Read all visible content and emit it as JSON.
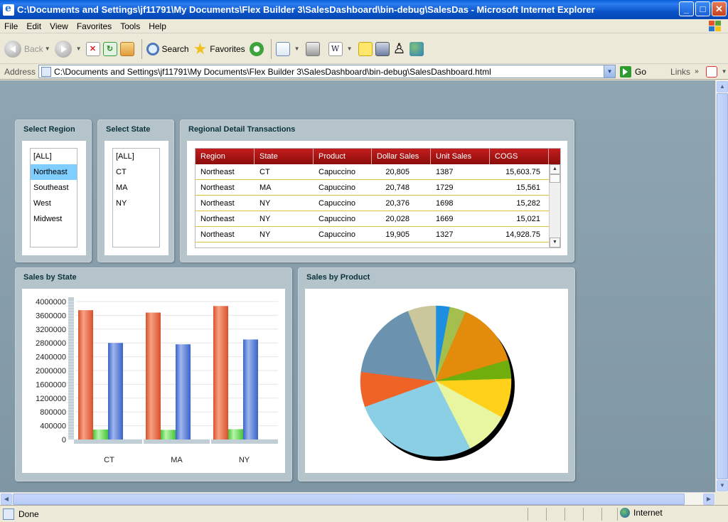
{
  "window": {
    "title": "C:\\Documents and Settings\\jf11791\\My Documents\\Flex Builder 3\\SalesDashboard\\bin-debug\\SalesDas - Microsoft Internet Explorer",
    "minimize": "_",
    "maximize": "□",
    "close": "✕"
  },
  "menu": [
    "File",
    "Edit",
    "View",
    "Favorites",
    "Tools",
    "Help"
  ],
  "toolbar": {
    "back": "Back",
    "search": "Search",
    "favorites": "Favorites"
  },
  "address": {
    "label": "Address",
    "url": "C:\\Documents and Settings\\jf11791\\My Documents\\Flex Builder 3\\SalesDashboard\\bin-debug\\SalesDashboard.html",
    "go": "Go",
    "links": "Links"
  },
  "status": {
    "text": "Done",
    "zone": "Internet"
  },
  "region_panel": {
    "title": "Select Region",
    "items": [
      "[ALL]",
      "Northeast",
      "Southeast",
      "West",
      "Midwest"
    ],
    "selected_index": 1
  },
  "state_panel": {
    "title": "Select State",
    "items": [
      "[ALL]",
      "CT",
      "MA",
      "NY"
    ]
  },
  "transactions": {
    "title": "Regional Detail Transactions",
    "columns": [
      "Region",
      "State",
      "Product",
      "Dollar Sales",
      "Unit Sales",
      "COGS"
    ],
    "rows": [
      [
        "Northeast",
        "CT",
        "Capuccino",
        "20,805",
        "1387",
        "15,603.75"
      ],
      [
        "Northeast",
        "MA",
        "Capuccino",
        "20,748",
        "1729",
        "15,561"
      ],
      [
        "Northeast",
        "NY",
        "Capuccino",
        "20,376",
        "1698",
        "15,282"
      ],
      [
        "Northeast",
        "NY",
        "Capuccino",
        "20,028",
        "1669",
        "15,021"
      ],
      [
        "Northeast",
        "NY",
        "Capuccino",
        "19,905",
        "1327",
        "14,928.75"
      ]
    ]
  },
  "sales_by_state": {
    "title": "Sales by State"
  },
  "sales_by_product": {
    "title": "Sales by Product"
  },
  "colors": {
    "bar_red": "#d9502b",
    "bar_green": "#47c43a",
    "bar_blue": "#3a64c8",
    "grid_header": "#a51414",
    "selection": "#7fceff"
  },
  "chart_data": [
    {
      "type": "bar",
      "categories": [
        "CT",
        "MA",
        "NY"
      ],
      "series": [
        {
          "values": [
            3750000,
            3680000,
            3870000
          ]
        },
        {
          "values": [
            290000,
            280000,
            300000
          ]
        },
        {
          "values": [
            2800000,
            2760000,
            2900000
          ]
        }
      ],
      "yticks": [
        0,
        400000,
        800000,
        1200000,
        1600000,
        2000000,
        2400000,
        2800000,
        3200000,
        3600000,
        4000000
      ],
      "ylim": [
        0,
        4000000
      ],
      "grid": true
    },
    {
      "type": "pie",
      "slices": [
        {
          "value": 3.0,
          "color": "#1e8fe0"
        },
        {
          "value": 3.5,
          "color": "#a4bf4e"
        },
        {
          "value": 14.0,
          "color": "#e38b0a"
        },
        {
          "value": 4.0,
          "color": "#6fae0c"
        },
        {
          "value": 8.5,
          "color": "#ffd11a"
        },
        {
          "value": 9.5,
          "color": "#e9f6a1"
        },
        {
          "value": 27.0,
          "color": "#8bcfe4"
        },
        {
          "value": 7.5,
          "color": "#f06327"
        },
        {
          "value": 17.0,
          "color": "#6b93b0"
        },
        {
          "value": 6.0,
          "color": "#cbc79c"
        }
      ]
    }
  ]
}
